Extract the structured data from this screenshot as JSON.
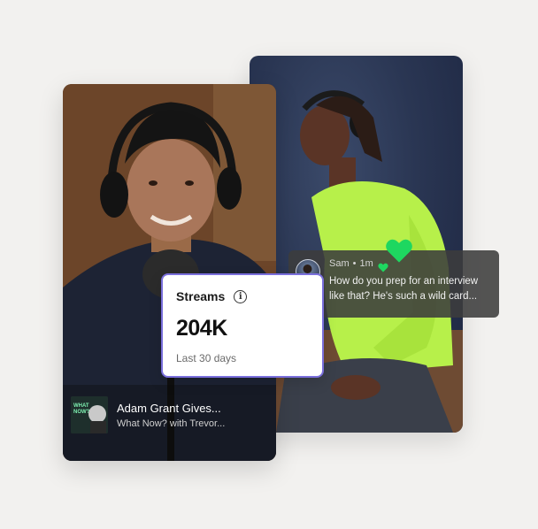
{
  "stats": {
    "title": "Streams",
    "info_glyph": "i",
    "value": "204K",
    "period": "Last 30 days",
    "border_color": "#7a6fdc"
  },
  "comment": {
    "author": "Sam",
    "separator": "•",
    "time": "1m",
    "text": "How do you prep for an interview like that? He's such a wild card...",
    "heart_color": "#1ed760"
  },
  "episode": {
    "title": "Adam Grant Gives...",
    "show": "What Now? with Trevor...",
    "art_text": "WHAT NOW?"
  },
  "icons": {
    "info": "info-icon",
    "heart": "heart-icon"
  }
}
